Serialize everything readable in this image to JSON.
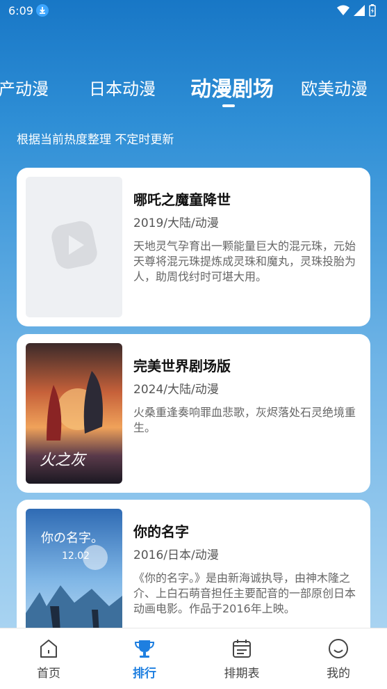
{
  "status": {
    "time": "6:09"
  },
  "tabs": [
    {
      "label": "国产动漫",
      "active": false
    },
    {
      "label": "日本动漫",
      "active": false
    },
    {
      "label": "动漫剧场",
      "active": true
    },
    {
      "label": "欧美动漫",
      "active": false
    }
  ],
  "subtitle": "根据当前热度整理 不定时更新",
  "items": [
    {
      "title": "哪吒之魔童降世",
      "meta": "2019/大陆/动漫",
      "desc": "天地灵气孕育出一颗能量巨大的混元珠，元始天尊将混元珠提炼成灵珠和魔丸，灵珠投胎为人，助周伐纣时可堪大用。",
      "poster": "placeholder-play-icon"
    },
    {
      "title": "完美世界剧场版",
      "meta": "2024/大陆/动漫",
      "desc": "火桑重逢奏响罪血悲歌，灰烬落处石灵绝境重生。",
      "poster": "perfect-world-poster"
    },
    {
      "title": "你的名字",
      "meta": "2016/日本/动漫",
      "desc": "《你的名字。》是由新海诚执导，由神木隆之介、上白石萌音担任主要配音的一部原创日本动画电影。作品于2016年上映。",
      "poster": "your-name-poster"
    }
  ],
  "nav": [
    {
      "label": "首页",
      "icon": "home-icon",
      "active": false
    },
    {
      "label": "排行",
      "icon": "trophy-icon",
      "active": true
    },
    {
      "label": "排期表",
      "icon": "calendar-icon",
      "active": false
    },
    {
      "label": "我的",
      "icon": "smile-icon",
      "active": false
    }
  ],
  "colors": {
    "accent": "#1e7fe0",
    "header": "#1877c6"
  }
}
